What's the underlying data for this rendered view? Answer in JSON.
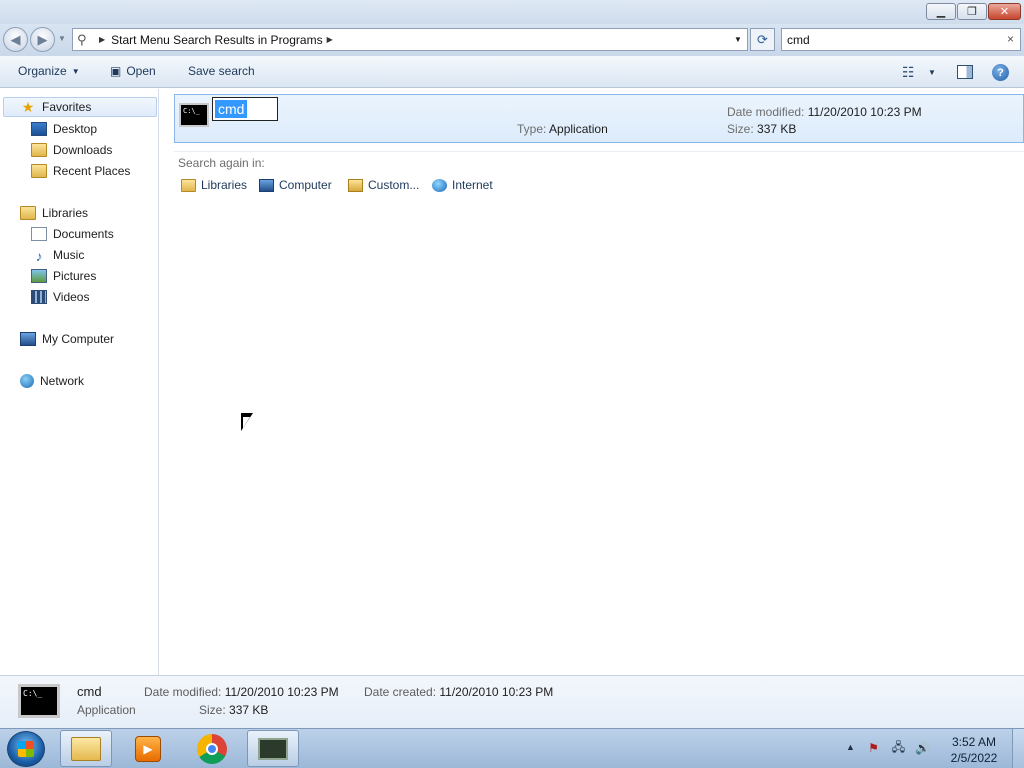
{
  "window": {
    "minimize": "▁",
    "maximize": "❐",
    "close": "✕"
  },
  "address": {
    "breadcrumb": "Start Menu Search Results in Programs",
    "search_value": "cmd",
    "search_clear": "×"
  },
  "toolbar": {
    "organize": "Organize",
    "open": "Open",
    "save_search": "Save search",
    "help": "?"
  },
  "nav": {
    "favorites": "Favorites",
    "desktop": "Desktop",
    "downloads": "Downloads",
    "recent_places": "Recent Places",
    "libraries": "Libraries",
    "documents": "Documents",
    "music": "Music",
    "pictures": "Pictures",
    "videos": "Videos",
    "my_computer": "My Computer",
    "network": "Network"
  },
  "result": {
    "name_edit": "cmd",
    "type_label": "Type:",
    "type_value": "Application",
    "date_modified_label": "Date modified:",
    "date_modified_value": "11/20/2010 10:23 PM",
    "size_label": "Size:",
    "size_value": "337 KB",
    "icon_text": "C:\\_"
  },
  "search_again": {
    "label": "Search again in:",
    "libraries": "Libraries",
    "computer": "Computer",
    "custom": "Custom...",
    "internet": "Internet"
  },
  "details": {
    "name": "cmd",
    "type": "Application",
    "date_modified_label": "Date modified:",
    "date_modified_value": "11/20/2010 10:23 PM",
    "size_label": "Size:",
    "size_value": "337 KB",
    "date_created_label": "Date created:",
    "date_created_value": "11/20/2010 10:23 PM",
    "icon_text": "C:\\_"
  },
  "taskbar": {
    "time": "3:52 AM",
    "date": "2/5/2022"
  },
  "icons": {
    "back": "back-arrow-icon",
    "forward": "forward-arrow-icon",
    "refresh": "refresh-icon",
    "favorites": "star-icon",
    "network": "globe-icon"
  },
  "colors": {
    "selection": "#3399ff",
    "link_text": "#1e395b",
    "label_gray": "#6d6d6d"
  }
}
